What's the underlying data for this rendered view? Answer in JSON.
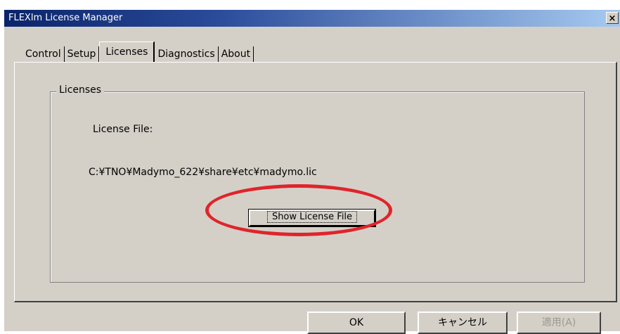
{
  "window": {
    "title": "FLEXlm License Manager",
    "close_symbol": "×"
  },
  "tabs": [
    {
      "label": "Control"
    },
    {
      "label": "Setup"
    },
    {
      "label": "Licenses",
      "active": true
    },
    {
      "label": "Diagnostics"
    },
    {
      "label": "About"
    }
  ],
  "licenses": {
    "group_label": "Licenses",
    "license_file_label": "License File:",
    "license_path": "C:¥TNO¥Madymo_622¥share¥etc¥madymo.lic",
    "show_button_label": "Show License File"
  },
  "buttons": {
    "ok_label": "OK",
    "cancel_label": "キャンセル",
    "apply_label": "適用(A)"
  },
  "colors": {
    "highlight": "#e0242b",
    "title_bar": "#0a246a",
    "dialog_bg": "#d4d0c8"
  }
}
